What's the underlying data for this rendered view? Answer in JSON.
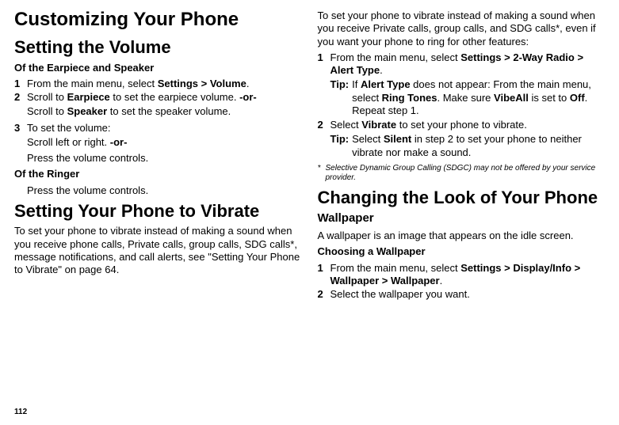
{
  "pageNumber": "112",
  "left": {
    "h1": "Customizing Your Phone",
    "h2a": "Setting the Volume",
    "h4a": "Of the Earpiece and Speaker",
    "l1": {
      "n1": "1",
      "t1a": "From the main menu, select ",
      "t1b": "Settings > Volume",
      "t1c": ".",
      "n2": "2",
      "t2a": "Scroll to ",
      "t2b": "Earpiece",
      "t2c": " to set the earpiece volume. ",
      "t2or": "-or-",
      "t2d": "Scroll to ",
      "t2e": "Speaker",
      "t2f": " to set the speaker volume.",
      "n3": "3",
      "t3": "To set the volume:",
      "t3a": "Scroll left or right. ",
      "t3or": "-or-",
      "t3b": "Press the volume controls."
    },
    "h4b": "Of the Ringer",
    "ringer": "Press the volume controls.",
    "h2b": "Setting Your Phone to Vibrate",
    "para1": "To set your phone to vibrate instead of making a sound when you receive phone calls, Private calls, group calls, SDG calls*, message notifications, and call alerts, see \"Setting Your Phone to Vibrate\" on page 64."
  },
  "right": {
    "para1": "To set your phone to vibrate instead of making a sound when you receive Private calls, group calls, and SDG calls*, even if you want your phone to ring for other features:",
    "l1": {
      "n1": "1",
      "t1a": "From the main menu, select ",
      "t1b": "Settings > 2-Way Radio > Alert Type",
      "t1c": ".",
      "tip1lbl": "Tip:",
      "tip1a": "If ",
      "tip1b": "Alert Type",
      "tip1c": " does not appear: From the main menu, select ",
      "tip1d": "Ring Tones",
      "tip1e": ". Make sure ",
      "tip1f": "VibeAll",
      "tip1g": " is set to ",
      "tip1h": "Off",
      "tip1i": ". Repeat step 1.",
      "n2": "2",
      "t2a": "Select ",
      "t2b": "Vibrate",
      "t2c": " to set your phone to vibrate.",
      "tip2lbl": "Tip:",
      "tip2a": "Select ",
      "tip2b": "Silent",
      "tip2c": " in step 2 to set your phone to neither vibrate nor make a sound."
    },
    "footmark": "*",
    "foot": "Selective Dynamic Group Calling (SDGC) may not be offered by your service provider.",
    "h2a": "Changing the Look of Your Phone",
    "h3a": "Wallpaper",
    "para2": "A wallpaper is an image that appears on the idle screen.",
    "h4a": "Choosing a Wallpaper",
    "l2": {
      "n1": "1",
      "t1a": "From the main menu, select ",
      "t1b": "Settings > Display/Info > Wallpaper > Wallpaper",
      "t1c": ".",
      "n2": "2",
      "t2": "Select the wallpaper you want."
    }
  }
}
